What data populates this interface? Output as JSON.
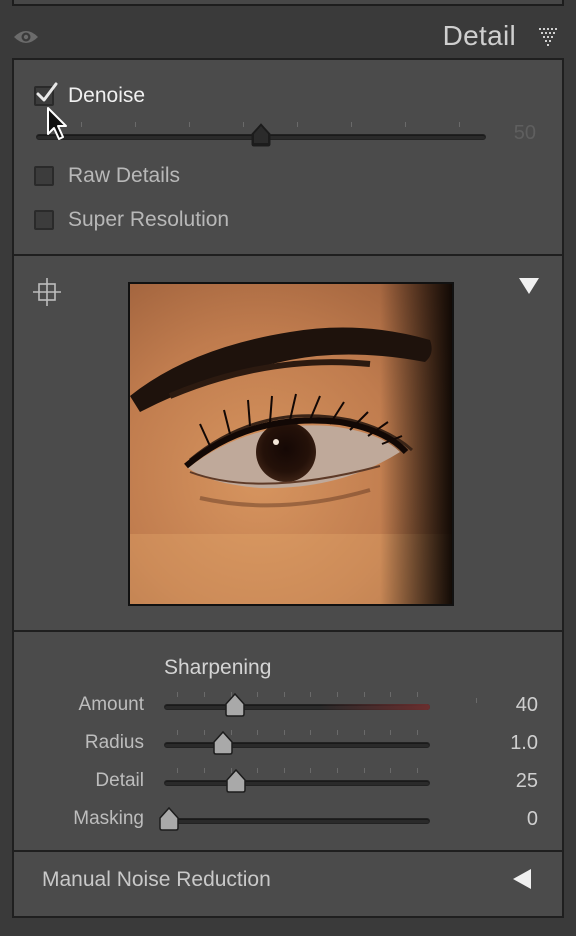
{
  "header": {
    "title": "Detail"
  },
  "denoise": {
    "checked": true,
    "label": "Denoise",
    "slider_value": "50",
    "slider_fraction": 0.5
  },
  "raw_details": {
    "label": "Raw Details",
    "checked": false
  },
  "super_resolution": {
    "label": "Super Resolution",
    "checked": false
  },
  "preview": {
    "image": "eye-closeup-photo"
  },
  "sharpening": {
    "title": "Sharpening",
    "rows": [
      {
        "label": "Amount",
        "value": "40",
        "fraction": 0.266
      },
      {
        "label": "Radius",
        "value": "1.0",
        "fraction": 0.22
      },
      {
        "label": "Detail",
        "value": "25",
        "fraction": 0.27
      },
      {
        "label": "Masking",
        "value": "0",
        "fraction": 0.0
      }
    ]
  },
  "manual_noise_reduction": {
    "label": "Manual Noise Reduction"
  },
  "colors": {
    "panel": "#4b4b4b",
    "background": "#3a3a3a",
    "amount_tail": "#6a2e2e"
  },
  "icons": [
    "eye-icon",
    "triangle-menu-icon",
    "checkmark-icon",
    "cursor-icon",
    "target-icon",
    "collapse-down-icon",
    "collapse-left-icon"
  ]
}
